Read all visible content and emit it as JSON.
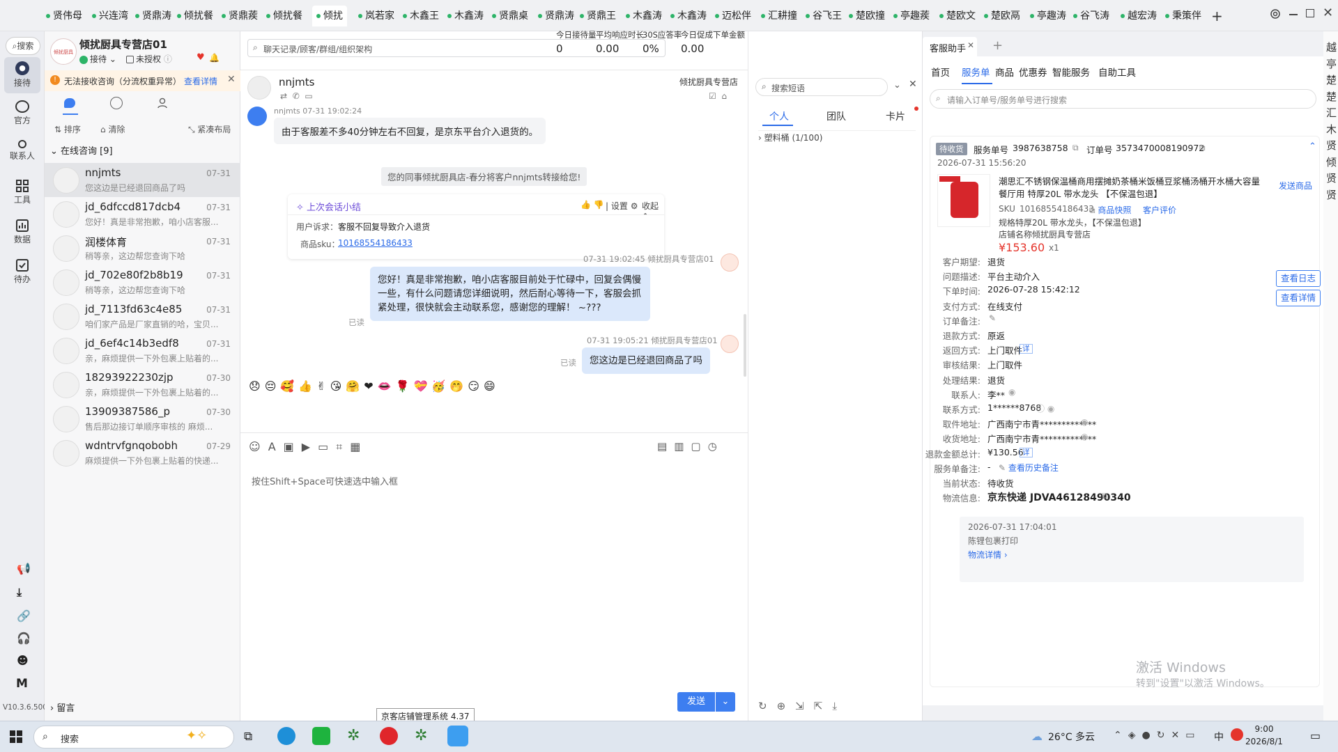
{
  "tabs": [
    "贤伟母",
    "兴连湾",
    "贤鼎涛",
    "倾扰餐",
    "贤鼎蒺",
    "倾扰餐",
    "倾扰",
    "岚若家",
    "木鑫王",
    "木鑫涛",
    "贤鼎桌",
    "贤鼎涛",
    "贤鼎王",
    "木鑫涛",
    "木鑫涛",
    "迈松伴",
    "汇耕撞",
    "谷飞王",
    "楚欧撞",
    "亭趣蒺",
    "楚欧文",
    "楚欧鬲",
    "亭趣涛",
    "谷飞涛",
    "越宏涛",
    "秉策伴"
  ],
  "left_nav": {
    "search": "搜索",
    "items": [
      "接待",
      "官方",
      "联系人",
      "工具",
      "数据",
      "待办"
    ],
    "bottom_letter": "M",
    "version": "V10.3.6.500"
  },
  "shop": {
    "name": "倾扰厨具专营店01",
    "status": "接待",
    "auth": "未授权",
    "avatar_text": "倾扰厨具"
  },
  "alert": {
    "text": "无法接收咨询（分流权重异常）",
    "link": "查看详情"
  },
  "list_toolbar": {
    "sort": "排序",
    "clear": "清除",
    "layout": "紧凑布局"
  },
  "online_header": "在线咨询 [9]",
  "conversations": [
    {
      "name": "nnjmts",
      "time": "07-31",
      "preview": "您这边是已经退回商品了吗"
    },
    {
      "name": "jd_6dfccd817dcb4",
      "time": "07-31",
      "preview": "您好！真是非常抱歉，咱小店客服..."
    },
    {
      "name": "润楼体育",
      "time": "07-31",
      "preview": "稍等亲，这边帮您查询下哈"
    },
    {
      "name": "jd_702e80f2b8b19",
      "time": "07-31",
      "preview": "稍等亲，这边帮您查询下哈"
    },
    {
      "name": "jd_7113fd63c4e85",
      "time": "07-31",
      "preview": "咱们家产品是厂家直销的哈，宝贝..."
    },
    {
      "name": "jd_6ef4c14b3edf8",
      "time": "07-31",
      "preview": "亲，麻烦提供一下外包裹上贴着的..."
    },
    {
      "name": "18293922230zjp",
      "time": "07-30",
      "preview": "亲，麻烦提供一下外包裹上贴着的..."
    },
    {
      "name": "13909387586_p",
      "time": "07-30",
      "preview": "售后那边接订单顺序审核的 麻烦..."
    },
    {
      "name": "wdntrvfgnqobobh",
      "time": "07-29",
      "preview": "麻烦提供一下外包裹上贴着的快递..."
    }
  ],
  "leave_msg": "留言",
  "search_bar": {
    "placeholder": "聊天记录/顾客/群组/组织架构"
  },
  "stats": [
    {
      "label": "今日接待量",
      "value": "0"
    },
    {
      "label": "平均响应时长",
      "value": "0.00"
    },
    {
      "label": "30S应答率",
      "value": "0%"
    },
    {
      "label": "今日促成下单金额",
      "value": "0.00"
    }
  ],
  "chat": {
    "customer": "nnjmts",
    "shop_label": "倾扰厨具专营店",
    "msg1_meta": "nnjmts  07-31 19:02:24",
    "msg1": "由于客服差不多40分钟左右不回复，是京东平台介入退货的。",
    "system": "您的同事倾扰厨具店-春分将客户nnjmts转接给您!",
    "summary_title": "上次会话小结",
    "summary_settings": "设置",
    "summary_collapse": "收起",
    "summary_k1": "用户诉求：",
    "summary_v1": "客服不回复导致介入退货",
    "summary_k2": "商品sku：",
    "summary_v2": "10168554186433",
    "msg2_meta": "07-31 19:02:45  倾扰厨具专营店01",
    "msg2": "您好！真是非常抱歉，咱小店客服目前处于忙碌中，回复会偶慢一些，有什么问题请您详细说明，然后耐心等待一下，客服会抓紧处理，很快就会主动联系您，感谢您的理解！ ~???",
    "read1": "已读",
    "msg3_meta": "07-31 19:05:21  倾扰厨具专营店01",
    "msg3": "您这边是已经退回商品了吗",
    "read2": "已读",
    "emojis": [
      "😞",
      "😔",
      "🥰",
      "👍",
      "✌",
      "😘",
      "🤗",
      "❤",
      "👄",
      "🌹",
      "💝",
      "🥳",
      "🤭",
      "😏",
      "😄"
    ],
    "input_placeholder": "按住Shift+Space可快速选中输入框",
    "send": "发送",
    "watermark": "倾扰厨具专营店01"
  },
  "phrases": {
    "search_placeholder": "搜索短语",
    "tabs": [
      "个人",
      "团队",
      "卡片"
    ],
    "group": "塑料桶 (1/100)"
  },
  "rpanel": {
    "title": "客服助手",
    "nav": [
      "首页",
      "服务单",
      "商品",
      "优惠券",
      "智能服务",
      "自助工具"
    ],
    "search_placeholder": "请输入订单号/服务单号进行搜索",
    "status_tag": "待收货",
    "service_no_label": "服务单号",
    "service_no": "3987638758",
    "order_no_label": "订单号",
    "order_no": "3573470008190972",
    "created": "2026-07-31 15:56:20",
    "product_title": "潮思汇不锈钢保温桶商用摆摊奶茶桶米饭桶豆浆桶汤桶开水桶大容量餐厅用 特厚20L 带水龙头 【不保温包退】",
    "sku_label": "SKU",
    "sku": "10168554186433",
    "snapshot": "商品快照",
    "review": "客户评价",
    "spec": "规格特厚20L 带水龙头，【不保温包退】",
    "shop_line": "店铺名称倾扰厨具专营店",
    "price": "¥153.60",
    "qty": "x1",
    "send_goods": "发送商品",
    "view_log": "查看日志",
    "view_detail": "查看详情",
    "rows": [
      {
        "k": "客户期望:",
        "v": "退货"
      },
      {
        "k": "问题描述:",
        "v": "平台主动介入"
      },
      {
        "k": "下单时间:",
        "v": "2026-07-28 15:42:12"
      },
      {
        "k": "支付方式:",
        "v": "在线支付"
      },
      {
        "k": "订单备注:",
        "v": ""
      },
      {
        "k": "退款方式:",
        "v": "原返"
      },
      {
        "k": "返回方式:",
        "v": "上门取件"
      },
      {
        "k": "审核结果:",
        "v": "上门取件"
      },
      {
        "k": "处理结果:",
        "v": "退货"
      },
      {
        "k": "联系人:",
        "v": "李**"
      },
      {
        "k": "联系方式:",
        "v": "1******8768"
      },
      {
        "k": "取件地址:",
        "v": "广西南宁市青*************"
      },
      {
        "k": "收货地址:",
        "v": "广西南宁市青*************"
      },
      {
        "k": "退款金额总计:",
        "v": "¥130.56"
      },
      {
        "k": "服务单备注:",
        "v": "-"
      },
      {
        "k": "当前状态:",
        "v": "待收货"
      },
      {
        "k": "物流信息:",
        "v": "京东快递 JDVA46128490340"
      }
    ],
    "detail_tag": "详",
    "history_remark": "查看历史备注",
    "logistics_time": "2026-07-31 17:04:01",
    "logistics_text": "陈锂包裹打印",
    "logistics_link": "物流详情",
    "side_chars": [
      "越",
      "亭",
      "楚",
      "楚",
      "汇",
      "木",
      "贤",
      "倾",
      "贤",
      "贤"
    ]
  },
  "windows_activate": {
    "line1": "激活 Windows",
    "line2": "转到\"设置\"以激活 Windows。"
  },
  "tooltip": "京客店铺管理系统 4.37",
  "taskbar": {
    "search": "搜索",
    "weather": "26°C 多云",
    "lang": "中",
    "time": "9:00",
    "date": "2026/8/1"
  },
  "colors": {
    "accent": "#2a6ae8",
    "green": "#2db468",
    "price": "#e5342b",
    "status_tag": "#8d96a5"
  }
}
